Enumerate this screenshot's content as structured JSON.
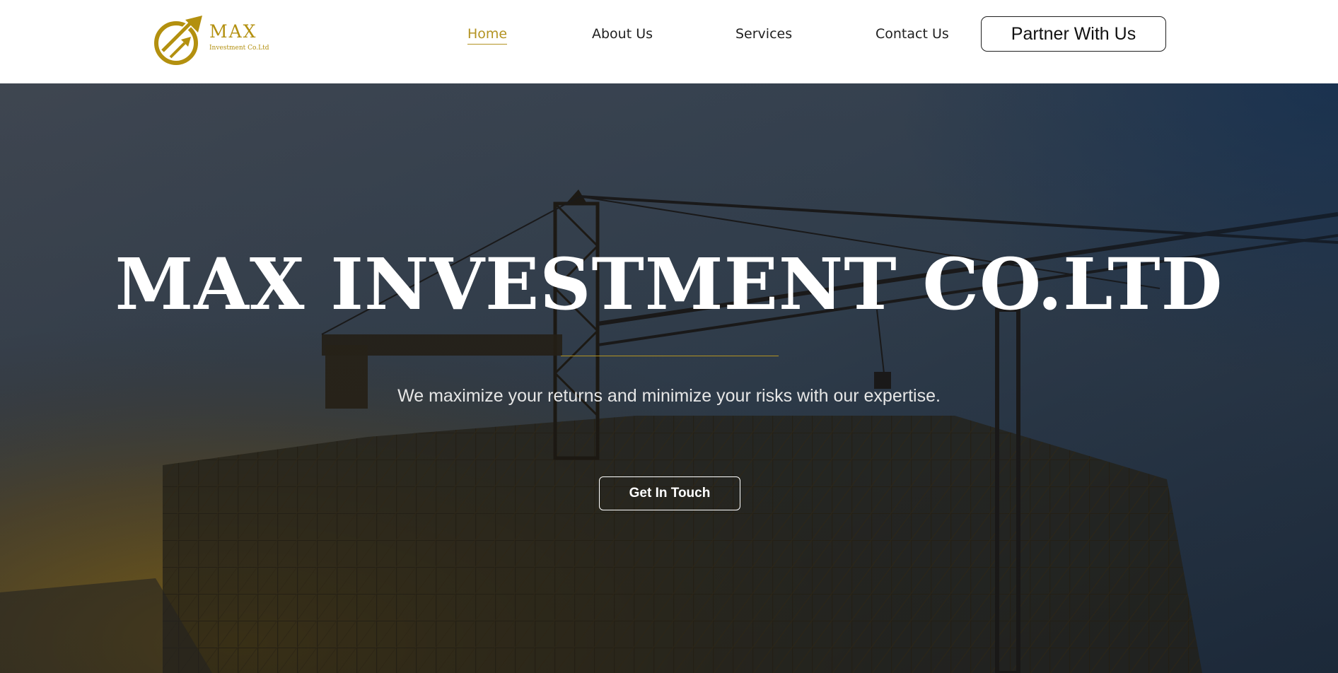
{
  "header": {
    "logo": {
      "icon": "rising-arrows-logo-icon",
      "wordmark": "MAX",
      "tagline": "Investment Co.Ltd",
      "color": "#b3900f"
    },
    "nav": [
      {
        "label": "Home",
        "active": true
      },
      {
        "label": "About Us",
        "active": false
      },
      {
        "label": "Services",
        "active": false
      },
      {
        "label": "Contact Us",
        "active": false
      }
    ],
    "partner_button": "Partner With Us"
  },
  "hero": {
    "background_image": "construction-site-crane-scaffolding",
    "title": "MAX INVESTMENT CO.LTD",
    "subtitle": "We maximize your returns and minimize your risks with our expertise.",
    "cta_button": "Get In Touch"
  },
  "colors": {
    "accent": "#b39322",
    "nav_text": "#1f1f1f",
    "hero_text": "#ffffff"
  }
}
